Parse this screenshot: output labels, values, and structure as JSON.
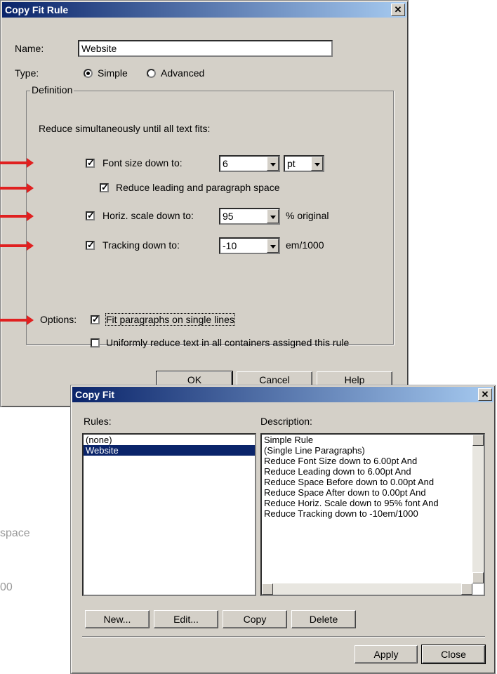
{
  "rule_dialog": {
    "title": "Copy Fit Rule",
    "name_label": "Name:",
    "name_value": "Website",
    "type_label": "Type:",
    "type_simple": "Simple",
    "type_advanced": "Advanced",
    "definition_label": "Definition",
    "reduce_text": "Reduce simultaneously until all text fits:",
    "font_size_label": "Font size down to:",
    "font_size_value": "6",
    "font_unit_value": "pt",
    "leading_label": "Reduce leading and paragraph space",
    "horiz_label": "Horiz. scale down to:",
    "horiz_value": "95",
    "horiz_unit": "% original",
    "tracking_label": "Tracking down to:",
    "tracking_value": "-10",
    "tracking_unit": "em/1000",
    "options_label": "Options:",
    "fit_single_label": "Fit paragraphs on single lines",
    "uniform_label": "Uniformly reduce text in all containers assigned this rule",
    "ok_label": "OK",
    "cancel_label": "Cancel",
    "help_label": "Help"
  },
  "copyfit_dialog": {
    "title": "Copy Fit",
    "rules_label": "Rules:",
    "description_label": "Description:",
    "rules": [
      "(none)",
      "Website"
    ],
    "selected_rule": "Website",
    "description_lines": [
      "Simple Rule",
      "(Single Line Paragraphs)",
      "Reduce Font Size down to 6.00pt And",
      "Reduce Leading down to 6.00pt And",
      "Reduce Space Before down to 0.00pt And",
      "Reduce Space After down to 0.00pt And",
      "Reduce Horiz. Scale down to 95% font And",
      "Reduce Tracking down to -10em/1000"
    ],
    "new_label": "New...",
    "edit_label": "Edit...",
    "copy_label": "Copy",
    "delete_label": "Delete",
    "apply_label": "Apply",
    "close_label": "Close"
  },
  "background_text": {
    "line1": "space",
    "line2": "00"
  },
  "colors": {
    "indicator_arrow": "#e02020",
    "title_gradient_start": "#0a246a",
    "selection": "#0a246a"
  }
}
